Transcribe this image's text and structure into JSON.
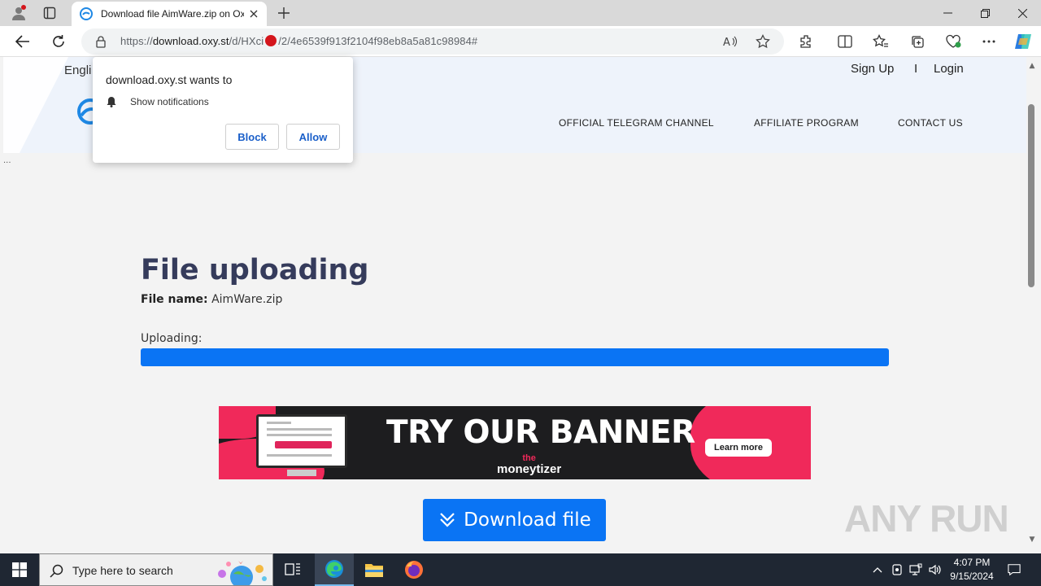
{
  "browser": {
    "tab_title": "Download file AimWare.zip on Oxy.st",
    "url_scheme": "https://",
    "url_domain": "download.oxy.st",
    "url_path_1": "/d/HXci",
    "url_path_2": "/2/4e6539f913f2104f98eb8a5a81c98984#"
  },
  "site": {
    "language": "Engli",
    "auth": {
      "signup": "Sign Up",
      "separator": "I",
      "login": "Login"
    },
    "nav": [
      "OFFICIAL TELEGRAM CHANNEL",
      "AFFILIATE PROGRAM",
      "CONTACT US"
    ],
    "ellipsis": "...",
    "heading": "File uploading",
    "file_label": "File name:",
    "file_name": "AimWare.zip",
    "uploading_label": "Uploading:",
    "progress": 1.0,
    "download_button": "Download file",
    "accent_color": "#0a74f4"
  },
  "banner": {
    "headline": "TRY OUR BANNER",
    "brand_top": "the",
    "brand": "moneytizer",
    "cta": "Learn more"
  },
  "permission_popup": {
    "title": "download.oxy.st wants to",
    "request": "Show notifications",
    "block": "Block",
    "allow": "Allow"
  },
  "watermark": "ANY RUN",
  "taskbar": {
    "search_placeholder": "Type here to search",
    "time": "4:07 PM",
    "date": "9/15/2024"
  }
}
